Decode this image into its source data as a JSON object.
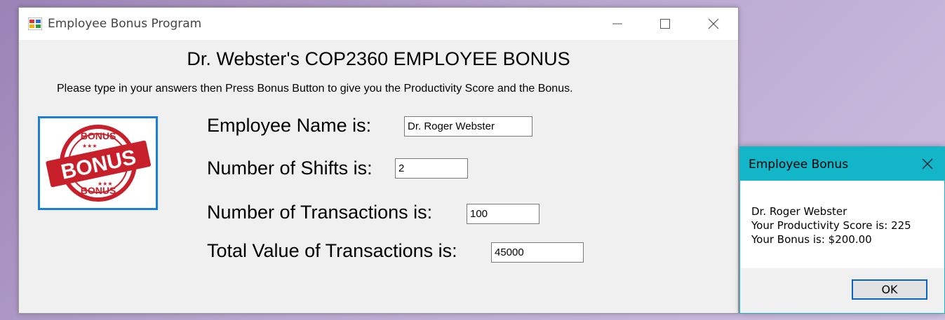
{
  "window": {
    "title": "Employee Bonus Program",
    "heading": "Dr. Webster's COP2360 EMPLOYEE BONUS",
    "instruction": "Please type in your answers then Press Bonus Button to give you the Productivity Score and the Bonus.",
    "bonus_image_text": "BONUS",
    "fields": [
      {
        "label": "Employee Name is:",
        "value": "Dr. Roger Webster"
      },
      {
        "label": "Number of Shifts is:",
        "value": "2"
      },
      {
        "label": "Number of Transactions is:",
        "value": "100"
      },
      {
        "label": "Total Value of Transactions is:",
        "value": "45000"
      }
    ]
  },
  "dialog": {
    "title": "Employee Bonus",
    "lines": [
      "Dr. Roger Webster",
      "Your Productivity Score is: 225",
      "Your Bonus is: $200.00"
    ],
    "ok_label": "OK"
  },
  "colors": {
    "dialog_accent": "#13b5c8",
    "image_border": "#1a7fd6",
    "stamp_red": "#c8202a"
  },
  "icons": [
    "app-icon",
    "minimize-icon",
    "maximize-icon",
    "close-icon",
    "dialog-close-icon"
  ]
}
